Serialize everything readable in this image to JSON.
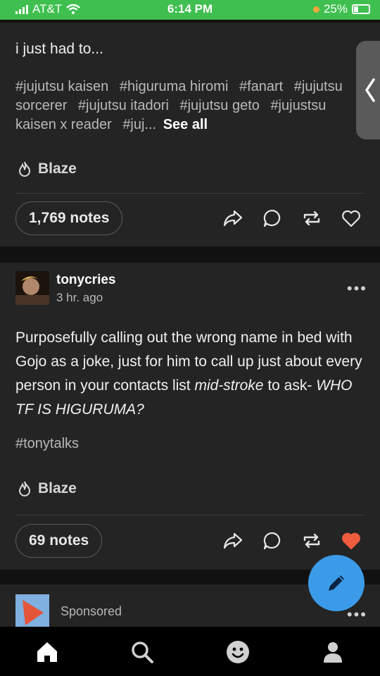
{
  "status_bar": {
    "carrier": "AT&T",
    "time": "6:14 PM",
    "battery": "25%"
  },
  "post1": {
    "text": "i just had to...",
    "tags": [
      "#jujutsu kaisen",
      "#higuruma hiromi",
      "#fanart",
      "#jujutsu sorcerer",
      "#jujutsu itadori",
      "#jujutsu geto",
      "#jujustsu kaisen x reader",
      "#juj..."
    ],
    "see_all": "See all",
    "blaze": "Blaze",
    "notes": "1,769 notes"
  },
  "post2": {
    "username": "tonycries",
    "time_ago": "3 hr. ago",
    "body_start": "Purposefully calling out the wrong name in bed with Gojo as a joke, just for him to call up just about every person in your contacts list ",
    "body_italic": "mid-stroke",
    "body_mid": " to ask- ",
    "body_end_italic": "WHO TF IS HIGURUMA?",
    "tag": "#tonytalks",
    "blaze": "Blaze",
    "notes": "69 notes",
    "liked": true
  },
  "post3": {
    "label": "Sponsored"
  },
  "colors": {
    "status_green": "#3fbf4f",
    "card_bg": "#242424",
    "fab_blue": "#3b9be8",
    "like_red": "#ef5b3f"
  },
  "icons": [
    "share-icon",
    "reply-icon",
    "reblog-icon",
    "heart-icon",
    "flame-icon",
    "pencil-icon",
    "home-icon",
    "search-icon",
    "smiley-icon",
    "person-icon"
  ]
}
